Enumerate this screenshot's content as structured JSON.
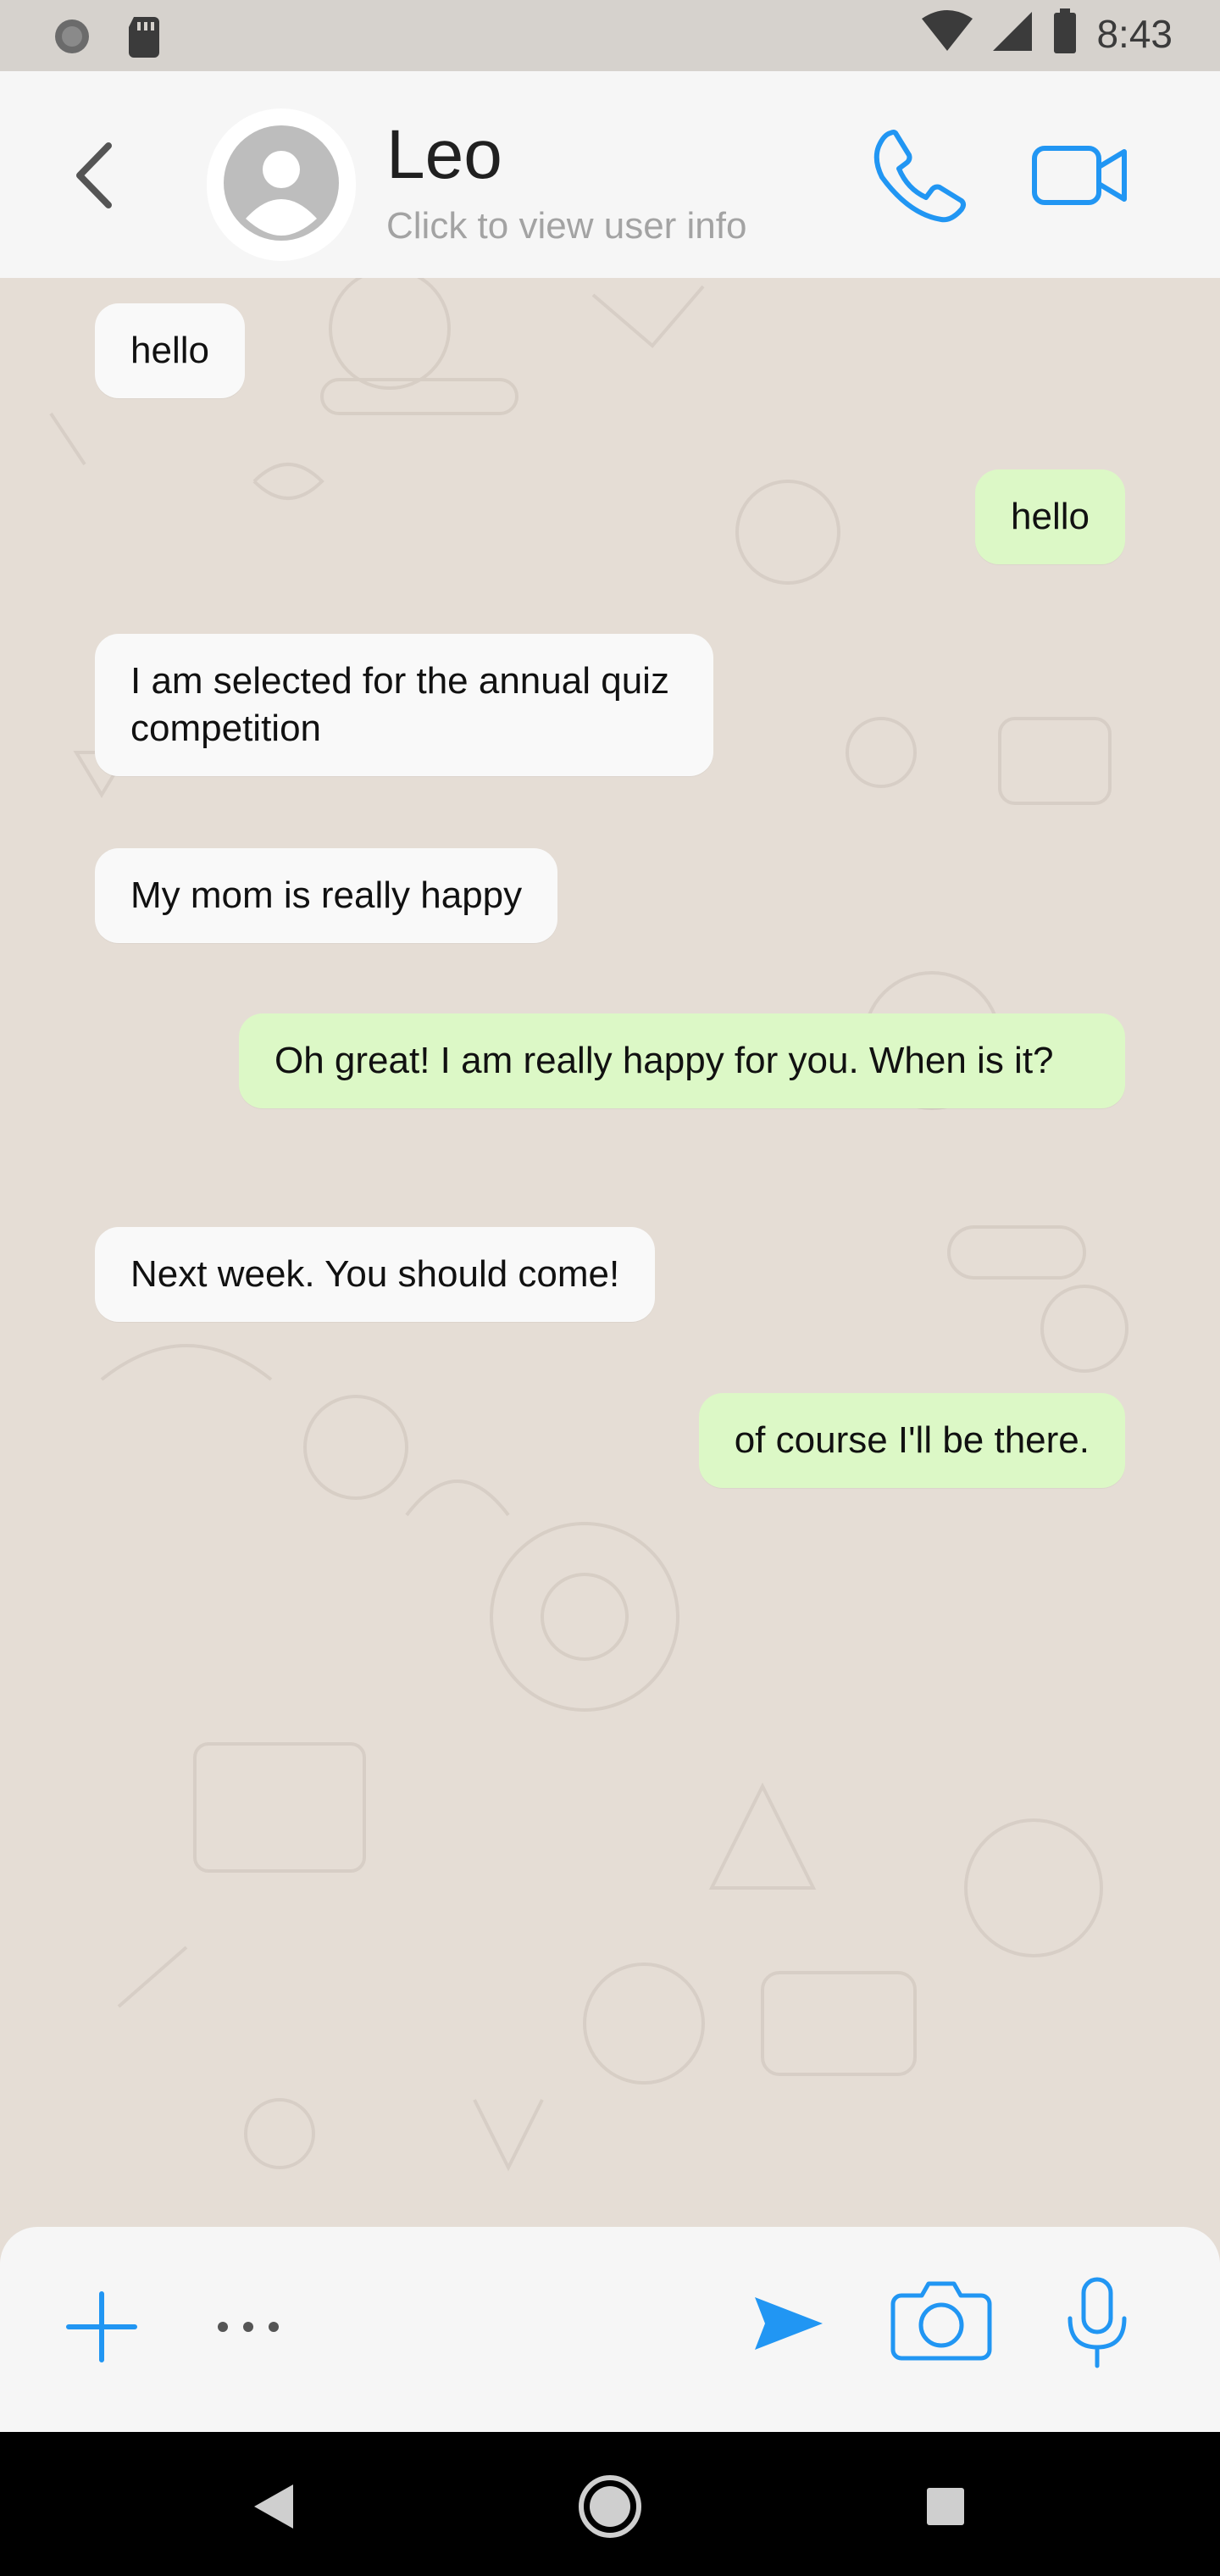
{
  "status_bar": {
    "time": "8:43",
    "icons": [
      "media-icon",
      "sd-card-icon",
      "wifi-icon",
      "signal-icon",
      "battery-icon"
    ]
  },
  "header": {
    "contact_name": "Leo",
    "subtitle": "Click to view user info",
    "icons": [
      "back-icon",
      "avatar-icon",
      "phone-icon",
      "video-camera-icon"
    ],
    "accent": "#2196f3"
  },
  "messages": [
    {
      "direction": "incoming",
      "text": "hello"
    },
    {
      "direction": "outgoing",
      "text": "hello"
    },
    {
      "direction": "incoming",
      "text": "I am selected for the annual quiz competition"
    },
    {
      "direction": "incoming",
      "text": "My mom is really happy"
    },
    {
      "direction": "outgoing",
      "text": "Oh great! I am really happy for you. When is it?"
    },
    {
      "direction": "incoming",
      "text": "Next week. You should come!"
    },
    {
      "direction": "outgoing",
      "text": "of course I'll be there."
    }
  ],
  "input_bar": {
    "icons": [
      "plus-icon",
      "more-icon",
      "send-icon",
      "camera-icon",
      "microphone-icon"
    ]
  },
  "nav_bar": {
    "icons": [
      "nav-back-icon",
      "nav-home-icon",
      "nav-recents-icon"
    ]
  },
  "colors": {
    "incoming_bubble": "#f9f9f9",
    "outgoing_bubble": "#dcf8c6",
    "chat_background": "#e5ddd5",
    "accent": "#2196f3"
  }
}
